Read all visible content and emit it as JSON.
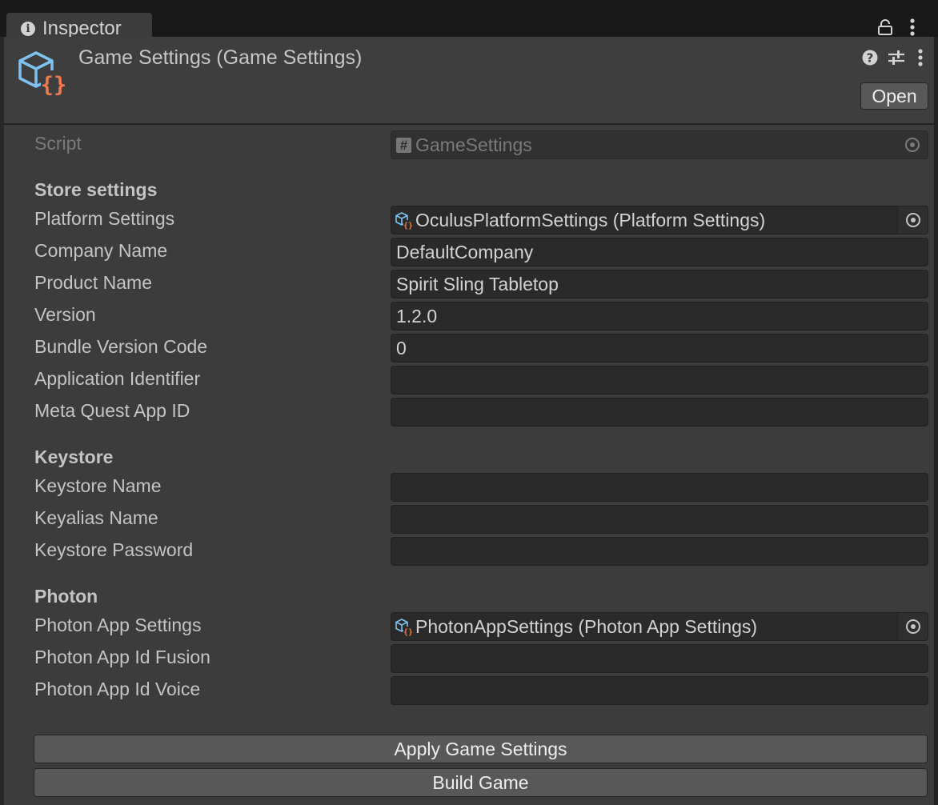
{
  "tab": {
    "label": "Inspector",
    "info_icon": "info-icon"
  },
  "toolbar": {
    "lock_icon": "lock-icon",
    "more_icon": "more-vertical-icon"
  },
  "header": {
    "title": "Game Settings (Game Settings)",
    "asset_icon": "scriptable-object-icon",
    "help_icon": "help-icon",
    "presets_icon": "presets-icon",
    "more_icon": "more-vertical-icon",
    "open_label": "Open"
  },
  "script_row": {
    "label": "Script",
    "value": "GameSettings",
    "hash_glyph": "#"
  },
  "store": {
    "header": "Store settings",
    "platform_settings": {
      "label": "Platform Settings",
      "value": "OculusPlatformSettings (Platform Settings)"
    },
    "company_name": {
      "label": "Company Name",
      "value": "DefaultCompany"
    },
    "product_name": {
      "label": "Product Name",
      "value": "Spirit Sling Tabletop"
    },
    "version": {
      "label": "Version",
      "value": "1.2.0"
    },
    "bundle_version_code": {
      "label": "Bundle Version Code",
      "value": "0"
    },
    "application_identifier": {
      "label": "Application Identifier",
      "value": ""
    },
    "meta_quest_app_id": {
      "label": "Meta Quest App ID",
      "value": ""
    }
  },
  "keystore": {
    "header": "Keystore",
    "keystore_name": {
      "label": "Keystore Name",
      "value": ""
    },
    "keyalias_name": {
      "label": "Keyalias Name",
      "value": ""
    },
    "keystore_password": {
      "label": "Keystore Password",
      "value": ""
    }
  },
  "photon": {
    "header": "Photon",
    "app_settings": {
      "label": "Photon App Settings",
      "value": "PhotonAppSettings (Photon App Settings)"
    },
    "app_id_fusion": {
      "label": "Photon App Id Fusion",
      "value": ""
    },
    "app_id_voice": {
      "label": "Photon App Id Voice",
      "value": ""
    }
  },
  "actions": {
    "apply_label": "Apply Game Settings",
    "build_label": "Build Game"
  },
  "colors": {
    "panel_bg": "#3c3c3c",
    "field_bg": "#2a2a2a",
    "button_bg": "#585858",
    "icon_blue": "#7fc2f0",
    "icon_orange": "#f07a4a"
  }
}
